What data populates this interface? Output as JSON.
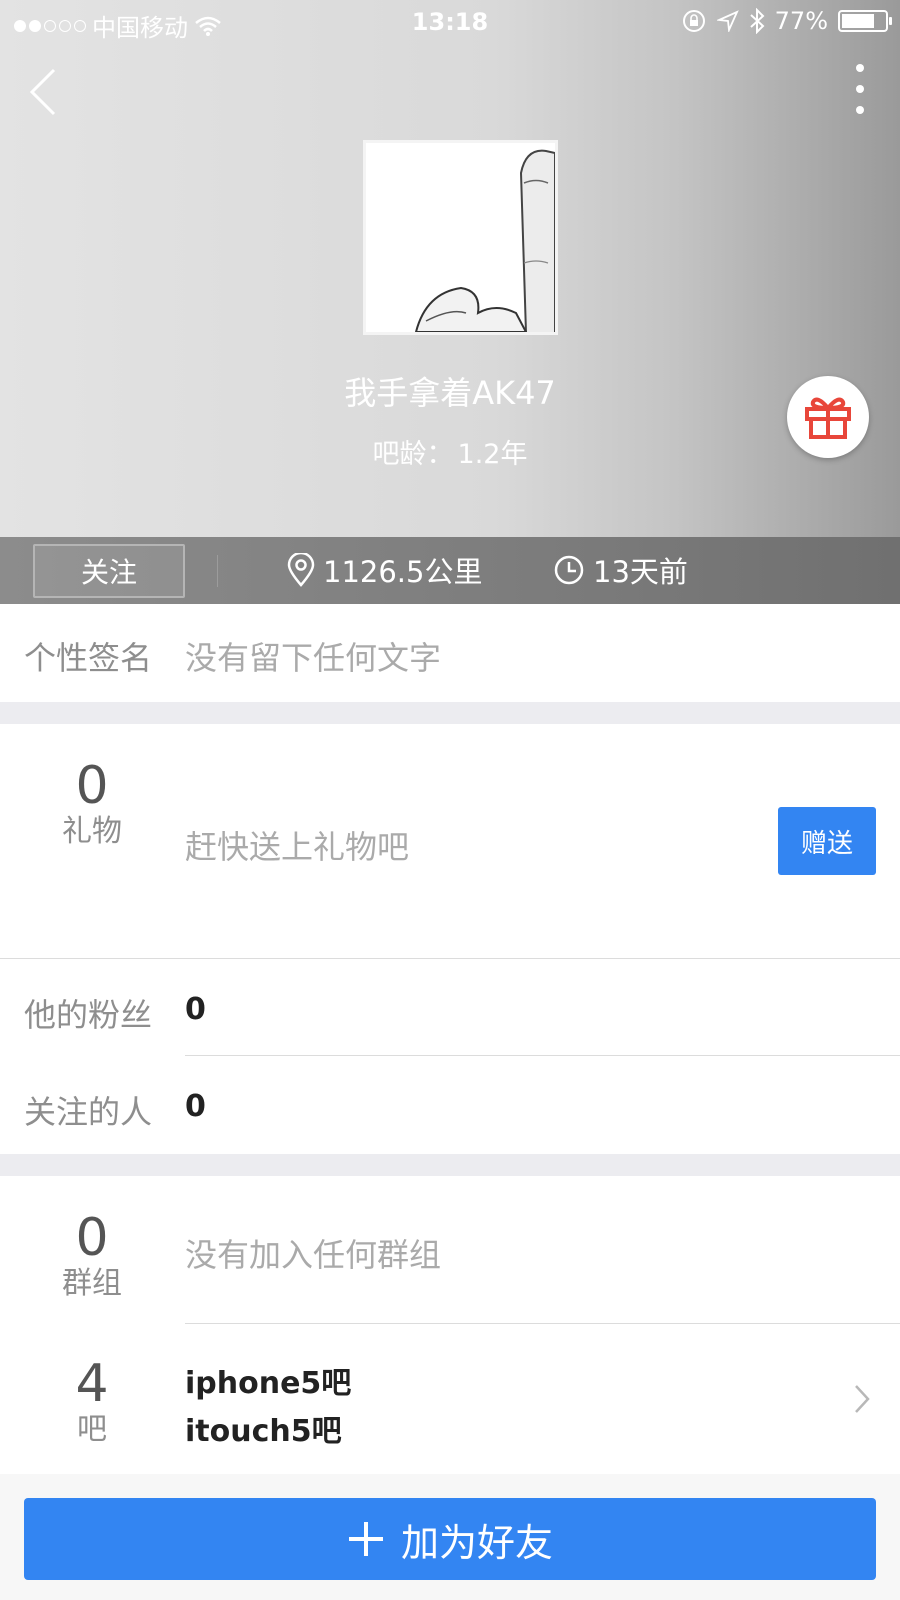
{
  "status_bar": {
    "carrier": "中国移动",
    "time": "13:18",
    "battery_text": "77%",
    "battery_level": 0.77
  },
  "profile": {
    "username": "我手拿着AK47",
    "age_label": "吧龄：",
    "age_value": "1.2年"
  },
  "info_strip": {
    "follow_label": "关注",
    "distance": "1126.5公里",
    "last_seen": "13天前"
  },
  "signature": {
    "label": "个性签名",
    "value": "没有留下任何文字"
  },
  "gifts": {
    "count": "0",
    "label": "礼物",
    "hint": "赶快送上礼物吧",
    "send_label": "赠送"
  },
  "fans": {
    "label": "他的粉丝",
    "value": "0"
  },
  "following": {
    "label": "关注的人",
    "value": "0"
  },
  "groups": {
    "count": "0",
    "label": "群组",
    "hint": "没有加入任何群组"
  },
  "bars": {
    "count": "4",
    "label": "吧",
    "items": [
      "iphone5吧",
      "itouch5吧"
    ]
  },
  "actions": {
    "add_friend_label": "加为好友"
  },
  "colors": {
    "accent": "#3385f2",
    "gift_icon": "#e8463a"
  },
  "icons": {
    "back": "chevron-left-icon",
    "more": "more-vertical-icon",
    "gift": "gift-icon",
    "location": "location-pin-icon",
    "clock": "clock-icon",
    "plus": "plus-icon",
    "chevron": "chevron-right-icon"
  }
}
